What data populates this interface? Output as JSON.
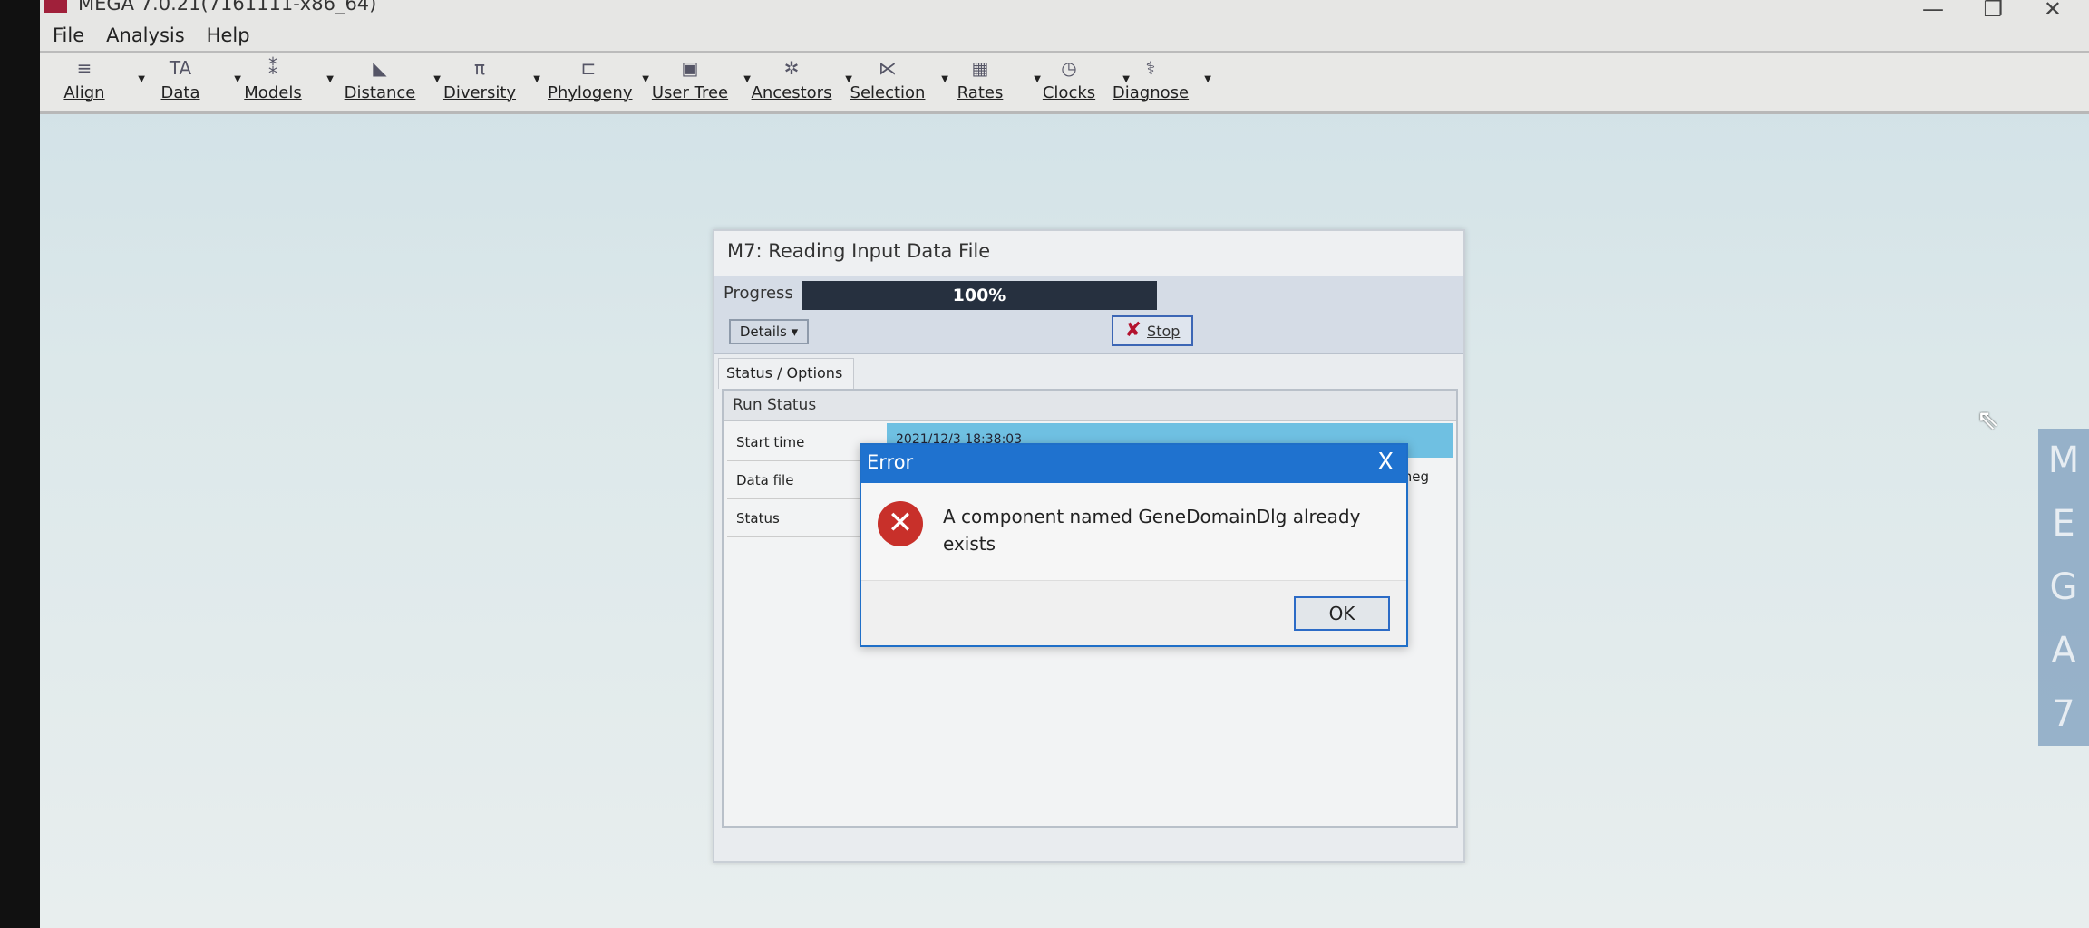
{
  "window": {
    "title": "MEGA 7.0.21(7161111-x86_64)",
    "minimize": "—",
    "restore": "❐",
    "close": "✕"
  },
  "menu": [
    "File",
    "Analysis",
    "Help"
  ],
  "toolbar": [
    {
      "label": "Align",
      "icon": "align-icon",
      "glyph": "≡"
    },
    {
      "label": "Data",
      "icon": "data-icon",
      "glyph": "TA"
    },
    {
      "label": "Models",
      "icon": "models-icon",
      "glyph": "⁑"
    },
    {
      "label": "Distance",
      "icon": "distance-icon",
      "glyph": "◣"
    },
    {
      "label": "Diversity",
      "icon": "diversity-icon",
      "glyph": "π"
    },
    {
      "label": "Phylogeny",
      "icon": "phylogeny-icon",
      "glyph": "⊏"
    },
    {
      "label": "User Tree",
      "icon": "user-tree-icon",
      "glyph": "▣"
    },
    {
      "label": "Ancestors",
      "icon": "ancestors-icon",
      "glyph": "✲"
    },
    {
      "label": "Selection",
      "icon": "selection-icon",
      "glyph": "⋉"
    },
    {
      "label": "Rates",
      "icon": "rates-icon",
      "glyph": "▦"
    },
    {
      "label": "Clocks",
      "icon": "clock-icon",
      "glyph": "◷"
    },
    {
      "label": "Diagnose",
      "icon": "caduceus-icon",
      "glyph": "⚕"
    }
  ],
  "progress_dialog": {
    "title": "M7: Reading Input Data File",
    "progress_label": "Progress",
    "progress_value": "100%",
    "progress_fraction": 1.0,
    "details_label": "Details ▾",
    "stop_label": "Stop",
    "tab": "Status / Options",
    "run_status": "Run Status",
    "rows": [
      {
        "label": "Start time",
        "value": "2021/12/3 18:38:03"
      },
      {
        "label": "Data file",
        "value": "med.meg"
      },
      {
        "label": "Status",
        "value": ""
      }
    ]
  },
  "error_dialog": {
    "title": "Error",
    "message": "A component named GeneDomainDlg already exists",
    "ok_label": "OK",
    "close": "X"
  },
  "side_logo": "MEGA7",
  "colors": {
    "progress_bar": "#26303f",
    "error_title": "#1f72cf",
    "error_icon": "#c8302a",
    "highlight": "#6fc0e2"
  }
}
